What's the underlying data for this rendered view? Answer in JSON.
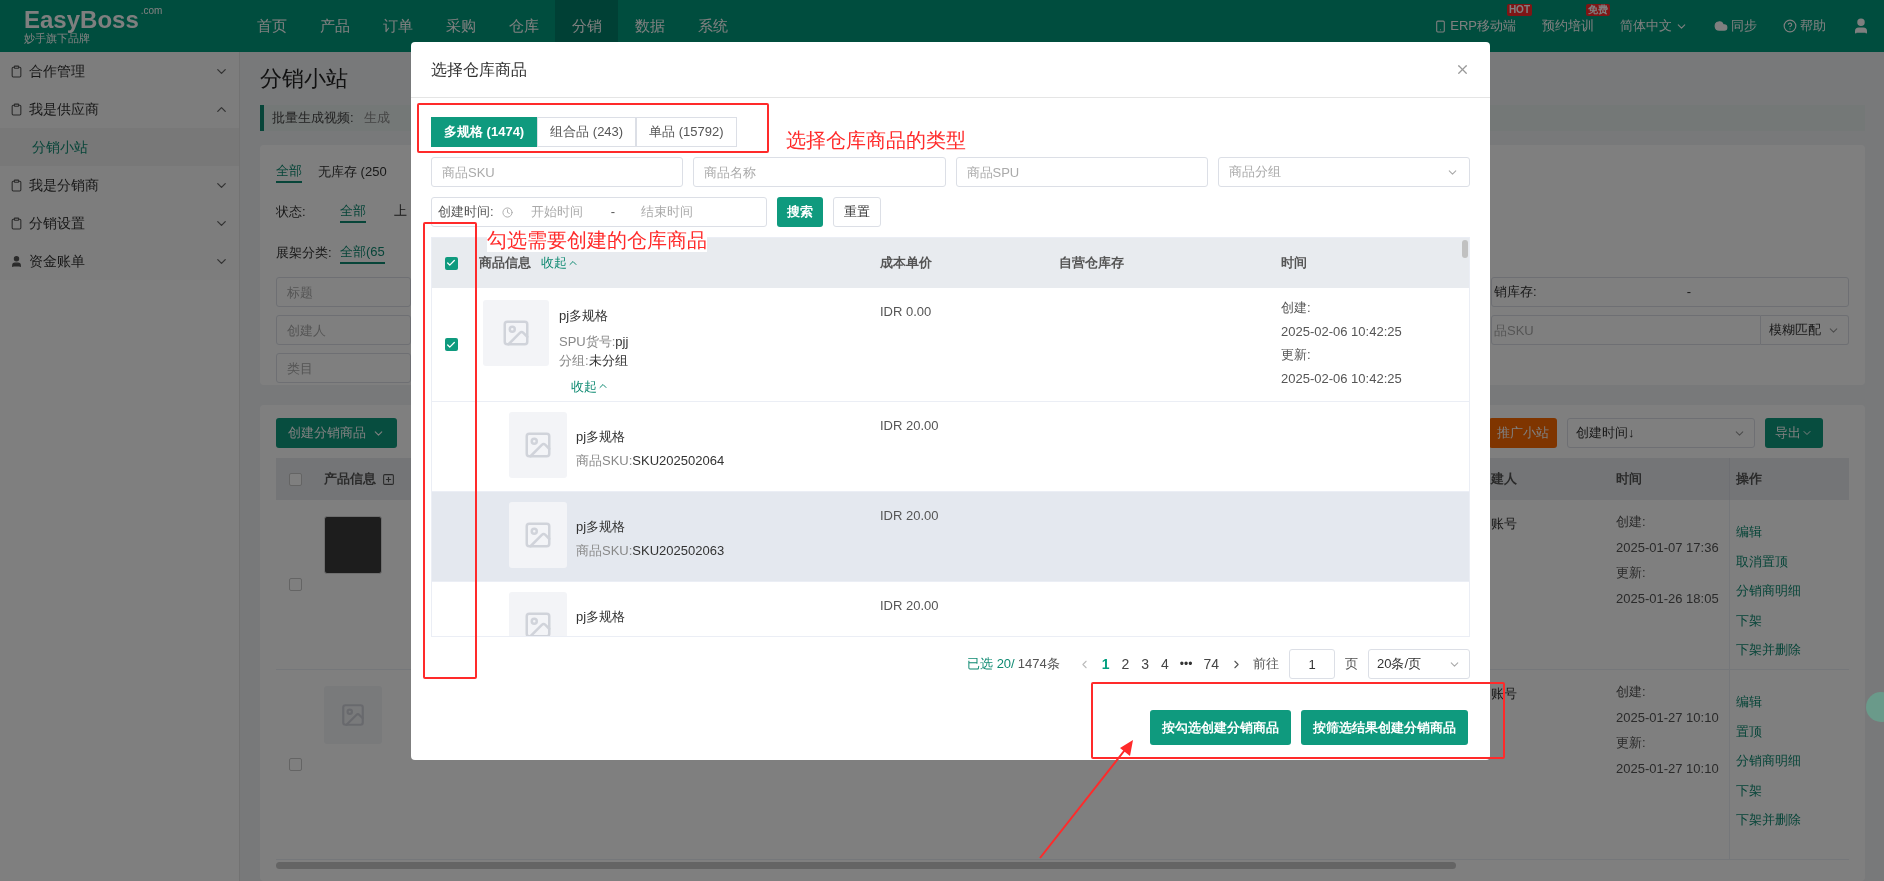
{
  "nav": {
    "logo": "EasyBoss",
    "logo_suffix": ".com",
    "logo_tagline": "妙手旗下品牌",
    "menu": [
      {
        "label": "首页",
        "selected": false
      },
      {
        "label": "产品",
        "selected": false
      },
      {
        "label": "订单",
        "selected": false
      },
      {
        "label": "采购",
        "selected": false
      },
      {
        "label": "仓库",
        "selected": false
      },
      {
        "label": "分销",
        "selected": true
      },
      {
        "label": "数据",
        "selected": false
      },
      {
        "label": "系统",
        "selected": false
      }
    ],
    "links": [
      {
        "kind": "mobile",
        "label": "ERP移动端",
        "badge": "HOT"
      },
      {
        "kind": "training",
        "label": "预约培训",
        "badge": "免费"
      },
      {
        "kind": "language",
        "label": "简体中文"
      },
      {
        "kind": "sync",
        "label": "同步"
      },
      {
        "kind": "help",
        "label": "帮助"
      }
    ]
  },
  "sidebar": {
    "items": [
      {
        "kind": "module",
        "label": "合作管理",
        "expanded": false
      },
      {
        "kind": "module",
        "label": "我是供应商",
        "expanded": true,
        "children": [
          {
            "label": "分销小站",
            "selected": true
          }
        ]
      },
      {
        "kind": "module",
        "label": "我是分销商",
        "expanded": false
      },
      {
        "kind": "module",
        "label": "分销设置",
        "expanded": false
      },
      {
        "kind": "account",
        "label": "资金账单",
        "expanded": false
      }
    ]
  },
  "page": {
    "title": "分销小站",
    "notice": {
      "label": "批量生成视频:",
      "value": "生成"
    },
    "filter_tabs": [
      {
        "label": "全部",
        "selected": true
      },
      {
        "label": "无库存 (250",
        "selected": false
      }
    ],
    "status": {
      "label": "状态:",
      "options": [
        {
          "label": "全部",
          "selected": true
        },
        {
          "label": "上",
          "selected": false
        }
      ]
    },
    "shelf": {
      "label": "展架分类:",
      "options": [
        {
          "label": "全部(65",
          "selected": true
        }
      ]
    },
    "fields": [
      {
        "placeholder": "标题"
      },
      {
        "placeholder": "创建人"
      },
      {
        "placeholder": "类目"
      }
    ],
    "stock_field": {
      "label": "销库存:",
      "value": "-"
    },
    "sku_field": {
      "placeholder": "品SKU",
      "match": "模糊匹配"
    },
    "toolbar": {
      "create": "创建分销商品",
      "promote": "推广小站",
      "sort": "创建时间↓",
      "export": "导出"
    },
    "table": {
      "all_checked": false,
      "column_product": "产品信息",
      "column_creator": "建人",
      "column_time": "时间",
      "column_actions": "操作",
      "rows": [
        {
          "checked": false,
          "creator": "账号",
          "created_label": "创建:",
          "created": "2025-01-07 17:36",
          "updated_label": "更新:",
          "updated": "2025-01-26 18:05",
          "actions": [
            "编辑",
            "取消置顶",
            "分销商明细",
            "下架",
            "下架并删除"
          ]
        },
        {
          "checked": false,
          "creator": "账号",
          "created_label": "创建:",
          "created": "2025-01-27 10:10",
          "updated_label": "更新:",
          "updated": "2025-01-27 10:10",
          "actions": [
            "编辑",
            "置顶",
            "分销商明细",
            "下架",
            "下架并删除"
          ]
        }
      ]
    }
  },
  "modal": {
    "title": "选择仓库商品",
    "type_tabs": [
      {
        "label": "多规格 (1474)",
        "selected": true
      },
      {
        "label": "组合品 (243)",
        "selected": false
      },
      {
        "label": "单品 (15792)",
        "selected": false
      }
    ],
    "filters": [
      {
        "kind": "text",
        "placeholder": "商品SKU"
      },
      {
        "kind": "text",
        "placeholder": "商品名称"
      },
      {
        "kind": "text",
        "placeholder": "商品SPU"
      },
      {
        "kind": "select",
        "placeholder": "商品分组"
      }
    ],
    "date_range": {
      "label": "创建时间:",
      "start_placeholder": "开始时间",
      "separator": "-",
      "end_placeholder": "结束时间"
    },
    "search_button": "搜索",
    "reset_button": "重置",
    "table": {
      "all_checked": true,
      "column_product": "商品信息",
      "collapse_all": "收起",
      "column_price": "成本单价",
      "column_stock": "自营仓库存",
      "column_time": "时间",
      "rows": [
        {
          "kind": "product",
          "checked": true,
          "name": "pj多规格",
          "spu_label": "SPU货号:",
          "spu": "pjj",
          "group_label": "分组:",
          "group": "未分组",
          "collapse": "收起",
          "price": "IDR 0.00",
          "created_label": "创建:",
          "created": "2025-02-06 10:42:25",
          "updated_label": "更新:",
          "updated": "2025-02-06 10:42:25"
        },
        {
          "kind": "variant",
          "name": "pj多规格",
          "sku_label": "商品SKU:",
          "sku": "SKU202502064",
          "price": "IDR 20.00",
          "highlighted": false
        },
        {
          "kind": "variant",
          "name": "pj多规格",
          "sku_label": "商品SKU:",
          "sku": "SKU202502063",
          "price": "IDR 20.00",
          "highlighted": true
        },
        {
          "kind": "variant",
          "name": "pj多规格",
          "price": "IDR 20.00",
          "highlighted": false
        }
      ]
    },
    "pagination": {
      "selected_label": "已选 20/",
      "total": "1474条",
      "pages": [
        {
          "kind": "page",
          "label": "1",
          "selected": true
        },
        {
          "kind": "page",
          "label": "2",
          "selected": false
        },
        {
          "kind": "page",
          "label": "3",
          "selected": false
        },
        {
          "kind": "page",
          "label": "4",
          "selected": false
        },
        {
          "kind": "ellipsis",
          "label": "•••",
          "selected": false
        },
        {
          "kind": "page",
          "label": "74",
          "selected": false
        }
      ],
      "goto_label": "前往",
      "goto_value": "1",
      "page_unit": "页",
      "page_size": "20条/页"
    },
    "actions": [
      "按勾选创建分销商品",
      "按筛选结果创建分销商品"
    ]
  },
  "annotations": [
    {
      "text": "选择仓库商品的类型"
    },
    {
      "text": "勾选需要创建的仓库商品"
    }
  ]
}
